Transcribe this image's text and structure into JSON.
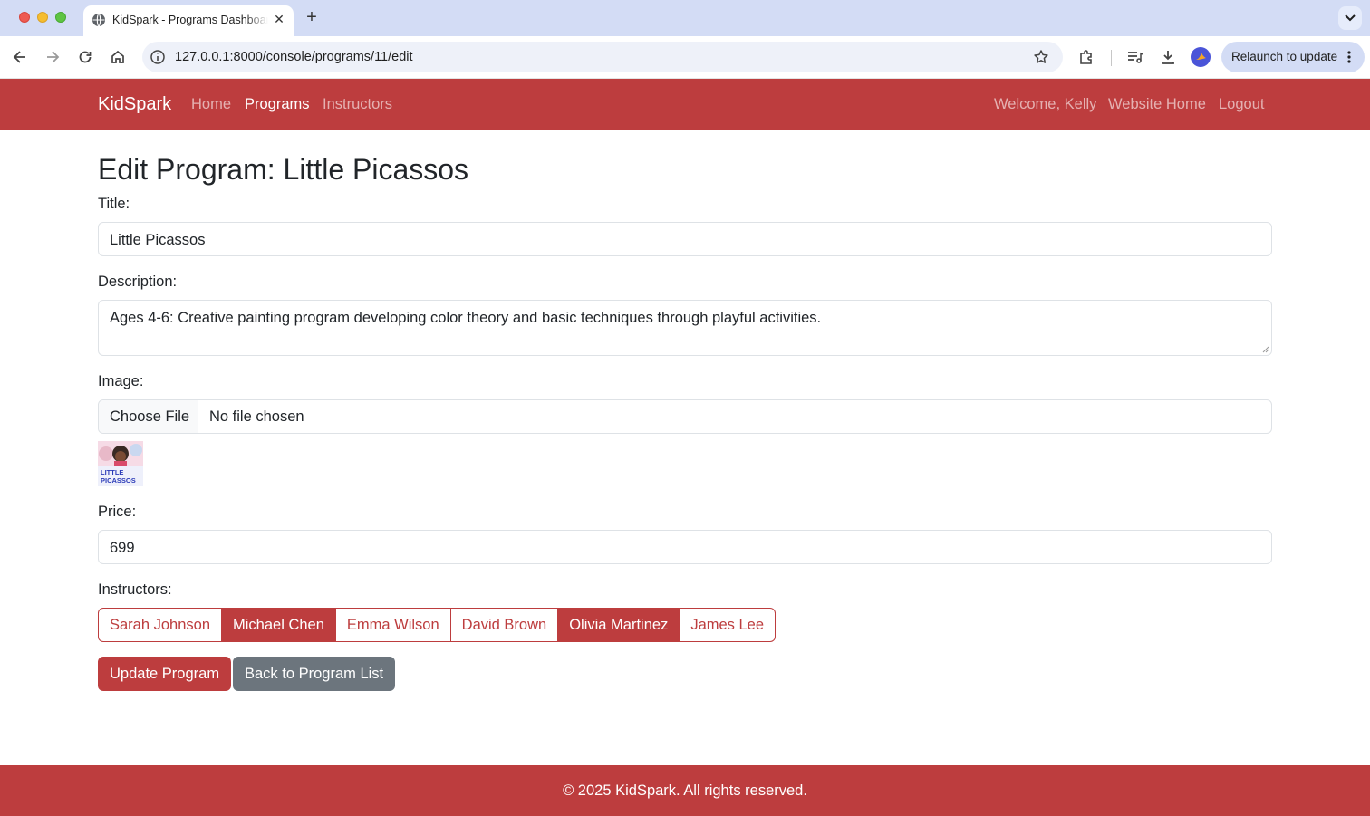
{
  "browser": {
    "tab_title": "KidSpark - Programs Dashboard",
    "url": "127.0.0.1:8000/console/programs/11/edit",
    "relaunch_label": "Relaunch to update"
  },
  "navbar": {
    "brand": "KidSpark",
    "links": [
      {
        "label": "Home",
        "active": false
      },
      {
        "label": "Programs",
        "active": true
      },
      {
        "label": "Instructors",
        "active": false
      }
    ],
    "right_links": [
      {
        "label": "Welcome, Kelly"
      },
      {
        "label": "Website Home"
      },
      {
        "label": "Logout"
      }
    ]
  },
  "form": {
    "heading": "Edit Program: Little Picassos",
    "title_label": "Title:",
    "title_value": "Little Picassos",
    "description_label": "Description:",
    "description_value": "Ages 4-6: Creative painting program developing color theory and basic techniques through playful activities.",
    "image_label": "Image:",
    "file_button": "Choose File",
    "file_status": "No file chosen",
    "thumbnail_text": "LITTLE PICASSOS",
    "price_label": "Price:",
    "price_value": "699",
    "instructors_label": "Instructors:",
    "instructors": [
      {
        "name": "Sarah Johnson",
        "selected": false
      },
      {
        "name": "Michael Chen",
        "selected": true
      },
      {
        "name": "Emma Wilson",
        "selected": false
      },
      {
        "name": "David Brown",
        "selected": false
      },
      {
        "name": "Olivia Martinez",
        "selected": true
      },
      {
        "name": "James Lee",
        "selected": false
      }
    ],
    "submit_label": "Update Program",
    "back_label": "Back to Program List"
  },
  "footer": {
    "text": "© 2025 KidSpark. All rights reserved."
  },
  "colors": {
    "brand": "#bd3d3e",
    "secondary": "#6c757d"
  }
}
